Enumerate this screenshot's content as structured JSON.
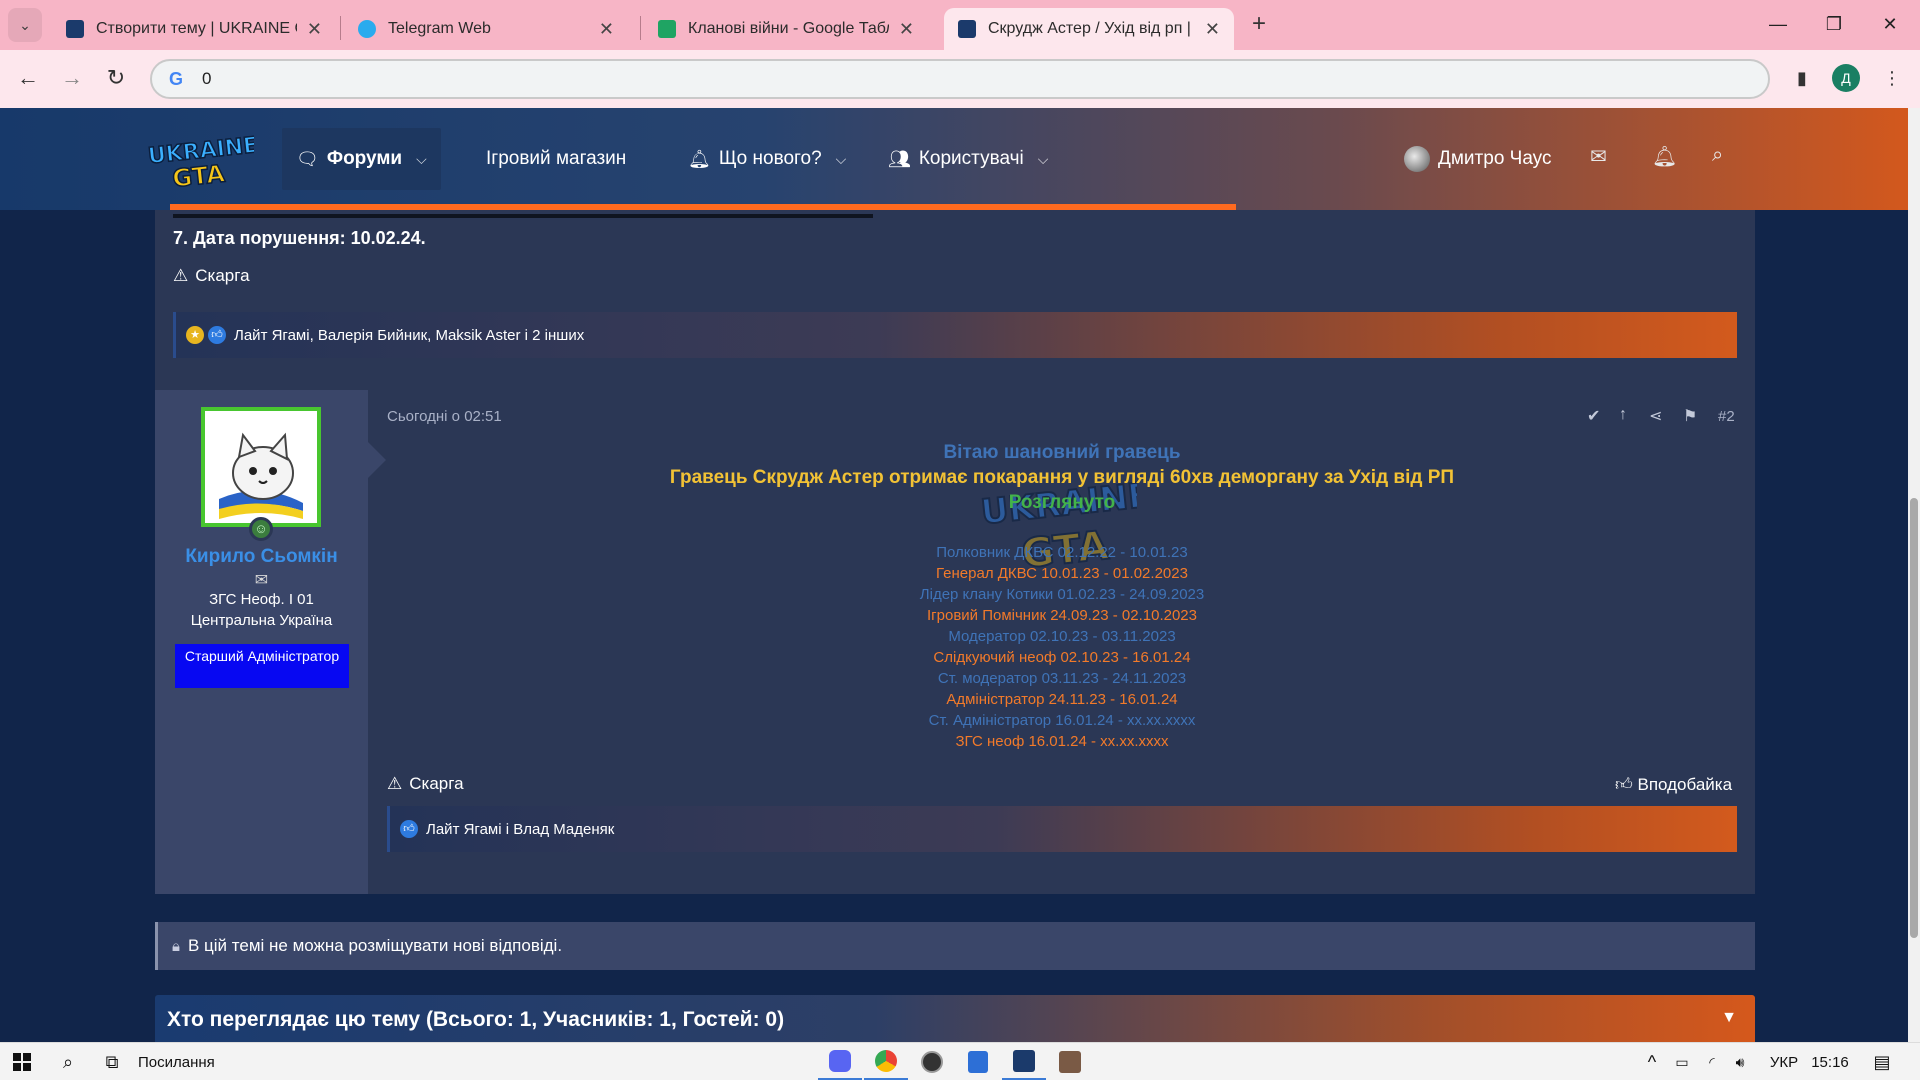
{
  "browser": {
    "tabs": [
      {
        "title": "Створити тему | UKRAINE GTA",
        "favicon_color": "#1b3a6b",
        "active": false
      },
      {
        "title": "Telegram Web",
        "favicon_color": "#2aabee",
        "active": false
      },
      {
        "title": "Кланові війни - Google Таблиц",
        "favicon_color": "#1fa463",
        "active": false
      },
      {
        "title": "Скрудж Астер / Ухід від рп | Uk",
        "favicon_color": "#1b3a6b",
        "active": true
      }
    ],
    "url": "0",
    "profile_initial": "Д"
  },
  "site_nav": {
    "items": [
      {
        "label": "Форуми",
        "icon": "chat-bubble-icon",
        "has_dropdown": true
      },
      {
        "label": "Ігровий магазин",
        "icon": "",
        "has_dropdown": false
      },
      {
        "label": "Що нового?",
        "icon": "bell-icon",
        "has_dropdown": true
      },
      {
        "label": "Користувачі",
        "icon": "users-icon",
        "has_dropdown": true
      }
    ],
    "user_name": "Дмитро Чаус"
  },
  "post1": {
    "tail_line": "7. Дата порушення: 10.02.24.",
    "report_label": "Скарга",
    "likes_text": "Лайт Ягамі, Валерія Бийник, Maksik Aster і 2 інших"
  },
  "post2": {
    "author": {
      "name": "Кирило Сьомкін",
      "title_line1": "ЗГС Неоф. I 01",
      "title_line2": "Центральна Україна",
      "badge": "Старший Адміністратор"
    },
    "date": "Сьогодні о 02:51",
    "number": "#2",
    "greeting": "Вітаю шановний гравець",
    "verdict": "Гравець Скрудж Астер отримає покарання у вигляді 60хв деморгану за Ухід від РП",
    "status": "Розглянуто",
    "signature": [
      "Полковник ДКВС 02.12.22 - 10.01.23",
      "Генерал ДКВС 10.01.23 - 01.02.2023",
      "Лідер клану Котики 01.02.23 - 24.09.2023",
      "Ігровий Помічник 24.09.23 - 02.10.2023",
      "Модератор 02.10.23 - 03.11.2023",
      "Слідкуючий неоф 02.10.23 - 16.01.24",
      "Ст. модератор 03.11.23 - 24.11.2023",
      "Адміністратор 24.11.23 - 16.01.24",
      "Ст. Адміністратор 16.01.24 - xx.xx.xxxx",
      "ЗГС неоф 16.01.24 - xx.xx.xxxx"
    ],
    "report_label": "Скарга",
    "like_label": "Вподобайка",
    "likes_text": "Лайт Ягамі і Влад Маденяк"
  },
  "thread_locked": "В цій темі не можна розміщувати нові відповіді.",
  "who_viewing": "Хто переглядає цю тему (Всього: 1, Учасників: 1, Гостей: 0)",
  "taskbar": {
    "search_label": "Посилання",
    "lang": "УКР",
    "time": "15:16"
  }
}
